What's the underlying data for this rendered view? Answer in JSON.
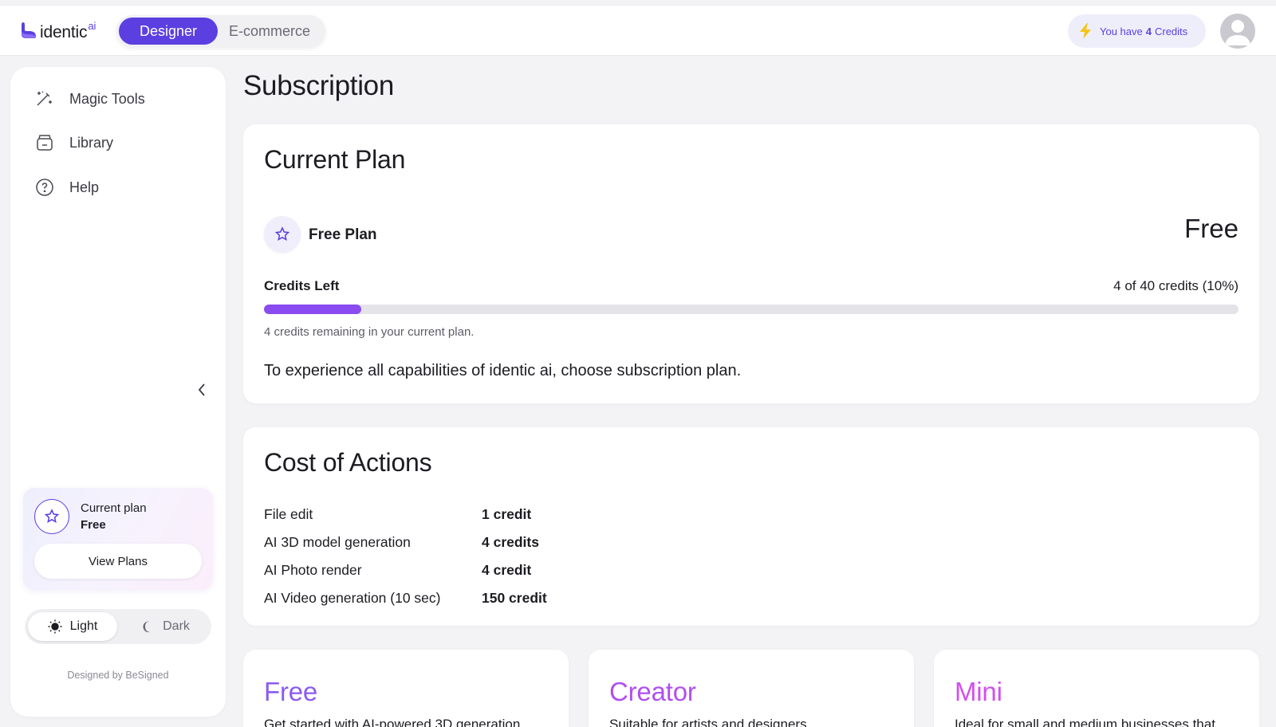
{
  "header": {
    "logo_text": "identic",
    "logo_sup": "ai",
    "modes": [
      {
        "label": "Designer",
        "active": true
      },
      {
        "label": "E-commerce",
        "active": false
      }
    ],
    "credits_prefix": "You have",
    "credits_count": "4",
    "credits_suffix": "Credits",
    "accent_color": "#5b3fe0"
  },
  "sidebar": {
    "items": [
      {
        "label": "Magic Tools",
        "icon": "magic-wand-icon"
      },
      {
        "label": "Library",
        "icon": "library-icon"
      },
      {
        "label": "Help",
        "icon": "help-icon"
      }
    ],
    "plan_card": {
      "title": "Current plan",
      "plan": "Free",
      "button": "View Plans"
    },
    "theme": {
      "light": "Light",
      "dark": "Dark",
      "selected": "Light"
    },
    "footer": "Designed by BeSigned"
  },
  "main": {
    "page_title": "Subscription",
    "current_plan": {
      "title": "Current Plan",
      "plan_name": "Free Plan",
      "price": "Free",
      "credits_label": "Credits Left",
      "credits_value": "4 of 40 credits (10%)",
      "credits_fraction": 0.1,
      "credits_note": "4 credits remaining in your current plan.",
      "upgrade_text": "To experience all capabilities of identic ai, choose subscription plan."
    },
    "cost_of_actions": {
      "title": "Cost of Actions",
      "rows": [
        {
          "action": "File edit",
          "cost": "1 credit"
        },
        {
          "action": "AI 3D model generation",
          "cost": "4 credits"
        },
        {
          "action": "AI Photo render",
          "cost": "4 credit"
        },
        {
          "action": "AI Video generation (10 sec)",
          "cost": "150 credit"
        }
      ]
    },
    "tiers": [
      {
        "name": "Free",
        "desc": "Get started with AI-powered 3D generation",
        "color": "#8a5cf0"
      },
      {
        "name": "Creator",
        "desc": "Suitable for artists and designers",
        "color": "#b04ff0"
      },
      {
        "name": "Mini",
        "desc": "Ideal for small and medium businesses that",
        "color": "#d34ff0"
      }
    ]
  }
}
